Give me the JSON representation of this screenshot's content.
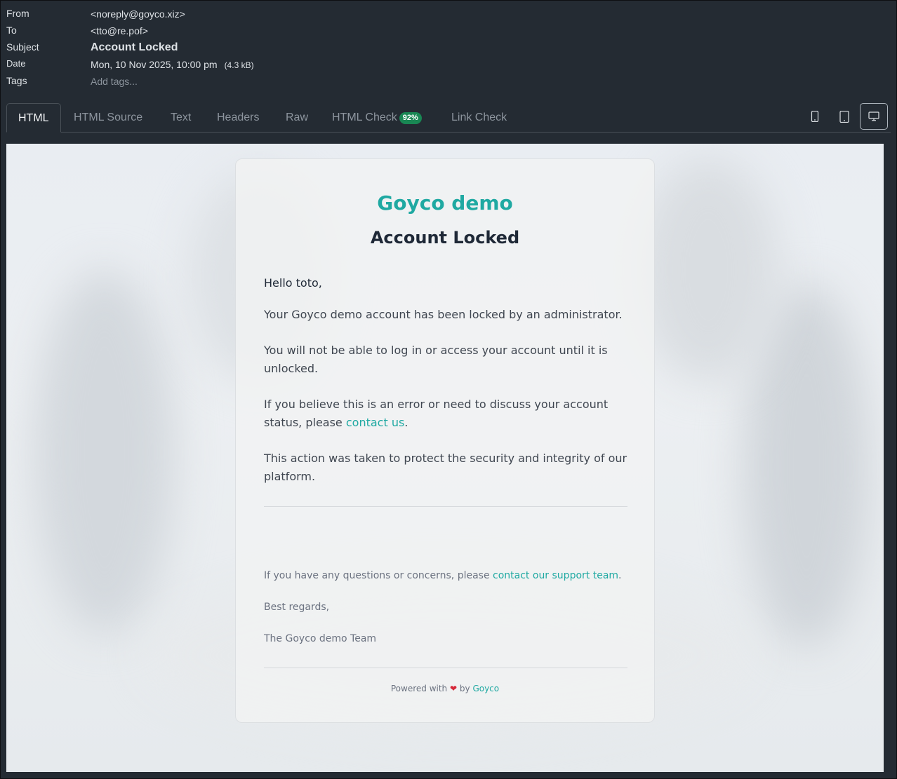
{
  "meta": {
    "from_label": "From",
    "from_value": "<noreply@goyco.xiz>",
    "to_label": "To",
    "to_value": "<tto@re.pof>",
    "subject_label": "Subject",
    "subject_value": "Account Locked",
    "date_label": "Date",
    "date_value": "Mon, 10 Nov 2025, 10:00 pm",
    "size_value": "(4.3 kB)",
    "tags_label": "Tags",
    "tags_placeholder": "Add tags..."
  },
  "tabs": [
    {
      "label": "HTML"
    },
    {
      "label": "HTML Source"
    },
    {
      "label": "Text"
    },
    {
      "label": "Headers"
    },
    {
      "label": "Raw"
    },
    {
      "label": "HTML Check",
      "badge": "92%"
    },
    {
      "label": "Link Check"
    }
  ],
  "device_icons": [
    "phone-icon",
    "tablet-icon",
    "desktop-icon"
  ],
  "email": {
    "brand": "Goyco demo",
    "headline": "Account Locked",
    "greeting": "Hello toto,",
    "p1": "Your Goyco demo account has been locked by an administrator.",
    "p2": "You will not be able to log in or access your account until it is unlocked.",
    "p3_prefix": "If you believe this is an error or need to discuss your account status, please ",
    "p3_link": "contact us",
    "p3_suffix": ".",
    "p4": "This action was taken to protect the security and integrity of our platform.",
    "questions_prefix": "If you have any questions or concerns, please ",
    "questions_link": "contact our support team",
    "questions_suffix": ".",
    "regards": "Best regards,",
    "team": "The Goyco demo Team",
    "powered_prefix": "Powered with",
    "powered_by": "by",
    "powered_link": "Goyco"
  },
  "colors": {
    "accent": "#1fa9a2",
    "badge": "#198754",
    "heart": "#d62839"
  }
}
